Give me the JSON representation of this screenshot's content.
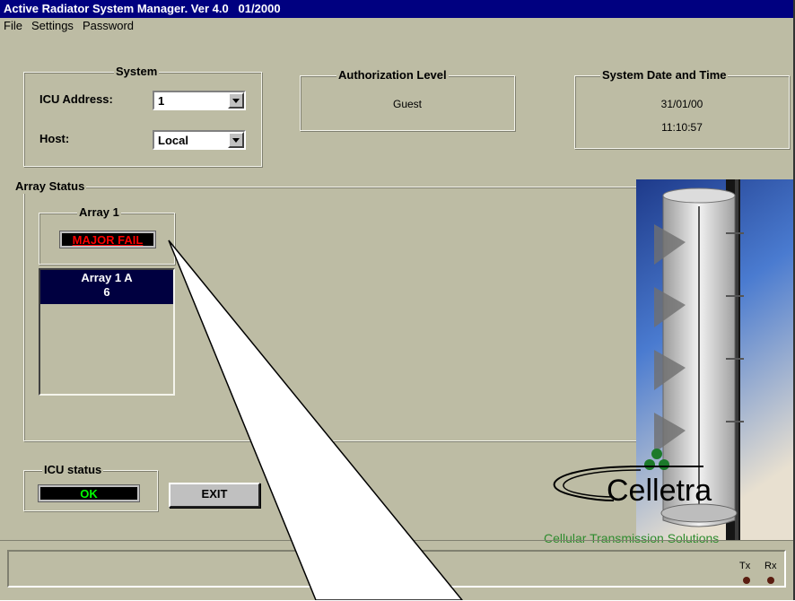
{
  "window": {
    "title": "Active Radiator System Manager. Ver 4.0   01/2000"
  },
  "menu": [
    "File",
    "Settings",
    "Password"
  ],
  "system": {
    "legend": "System",
    "icu_address_label": "ICU Address:",
    "icu_address_value": "1",
    "host_label": "Host:",
    "host_value": "Local"
  },
  "authorization": {
    "legend": "Authorization Level",
    "value": "Guest"
  },
  "datetime": {
    "legend": "System Date and Time",
    "date": "31/01/00",
    "time": "11:10:57"
  },
  "array_status": {
    "legend": "Array Status",
    "array_legend": "Array 1",
    "state": "MAJOR FAIL",
    "state_color": "#ff0000",
    "list_header": "Array 1 A",
    "list_value": "6"
  },
  "icu_status": {
    "legend": "ICU status",
    "value": "OK",
    "value_color": "#00ff00"
  },
  "exit_label": "EXIT",
  "logo": {
    "name": "Celletra",
    "tagline": "Cellular Transmission Solutions",
    "tagline_color": "#2e8b2e"
  },
  "indicators": {
    "tx": "Tx",
    "rx": "Rx"
  },
  "colors": {
    "titlebar": "#000080",
    "window_bg": "#bdbca4",
    "highlight": "#000040"
  }
}
